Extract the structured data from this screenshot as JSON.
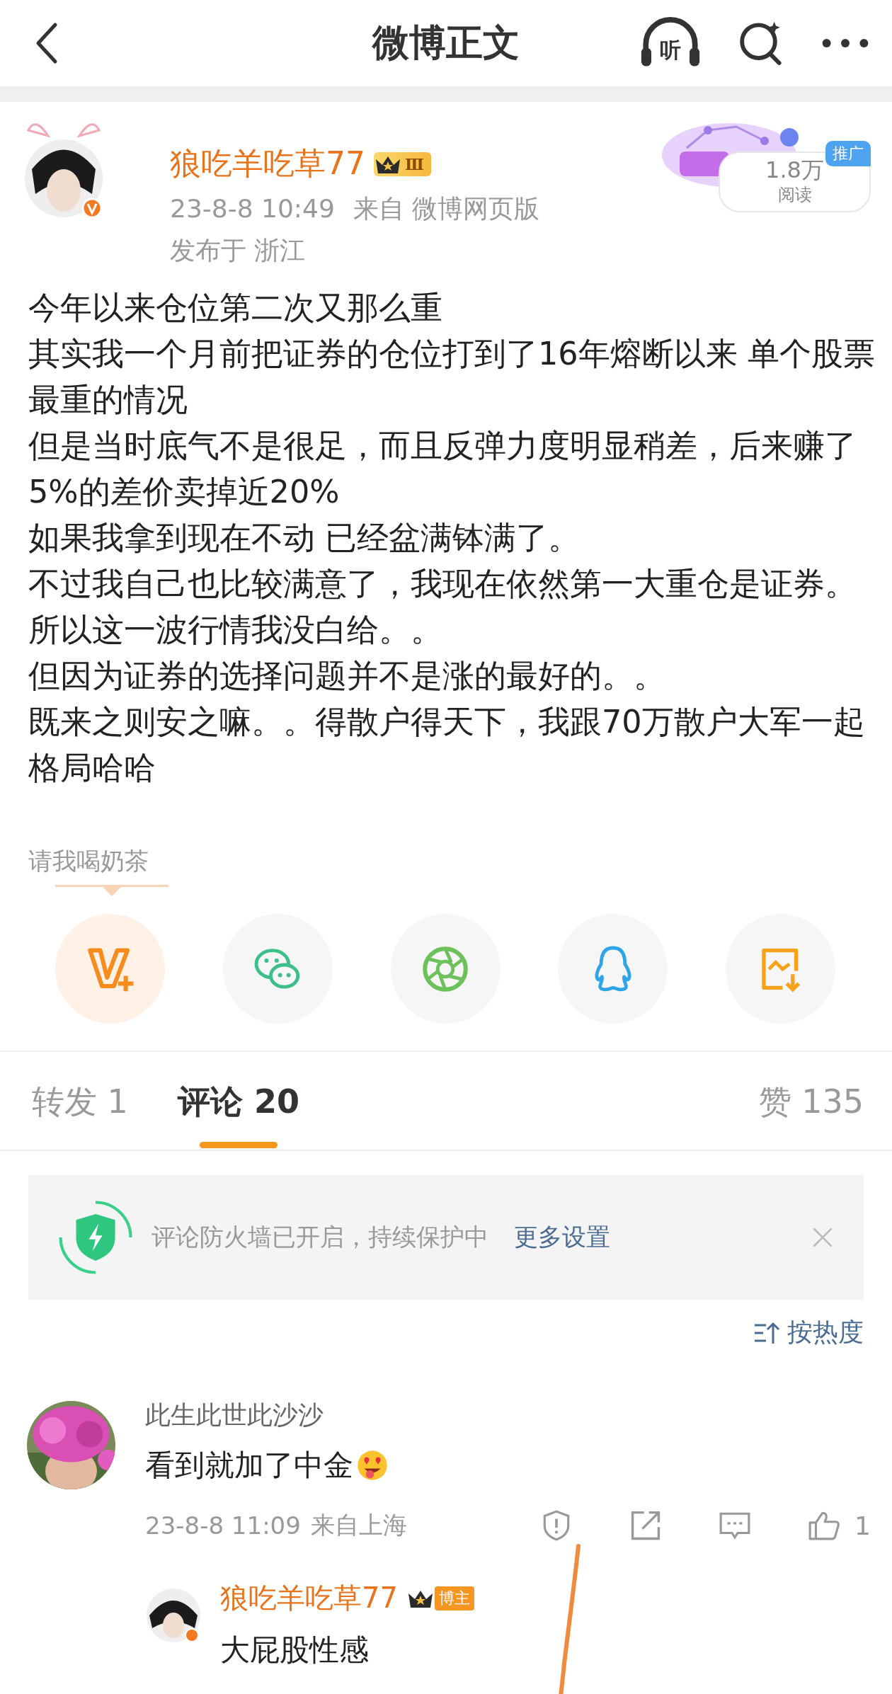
{
  "header": {
    "title": "微博正文",
    "listen_label": "听"
  },
  "post": {
    "author": "狼吃羊吃草77",
    "level_badge": "Ⅲ",
    "time": "23-8-8 10:49",
    "source": "来自 微博网页版",
    "location": "发布于 浙江",
    "reads": "1.8万",
    "reads_label": "阅读",
    "promo_tag": "推广",
    "paragraphs": [
      "今年以来仓位第二次又那么重",
      "其实我一个月前把证券的仓位打到了16年熔断以来  单个股票最重的情况",
      "但是当时底气不是很足，而且反弹力度明显稍差，后来赚了5%的差价卖掉近20%",
      "如果我拿到现在不动 已经盆满钵满了。",
      "不过我自己也比较满意了，我现在依然第一大重仓是证券。所以这一波行情我没白给。。",
      "但因为证券的选择问题并不是涨的最好的。。",
      "既来之则安之嘛。。得散户得天下，我跟70万散户大军一起格局哈哈"
    ]
  },
  "tip_label": "请我喝奶茶",
  "share": [
    {
      "kind": "vplus"
    },
    {
      "kind": "wechat"
    },
    {
      "kind": "moments"
    },
    {
      "kind": "qq"
    },
    {
      "kind": "save"
    }
  ],
  "tabs": [
    {
      "label": "转发 1",
      "selected": false
    },
    {
      "label": "评论 20",
      "selected": true
    }
  ],
  "likes": "赞 135",
  "firewall": {
    "text": "评论防火墙已开启，持续保护中",
    "link": "更多设置"
  },
  "sort": "按热度",
  "comments": [
    {
      "user": "此生此世此沙沙",
      "text": "看到就加了中金",
      "time": "23-8-8 11:09",
      "from": "来自上海",
      "like_count": "1",
      "reply": {
        "user": "狼吃羊吃草77",
        "badge": "博主",
        "text": "大屁股性感"
      }
    }
  ]
}
